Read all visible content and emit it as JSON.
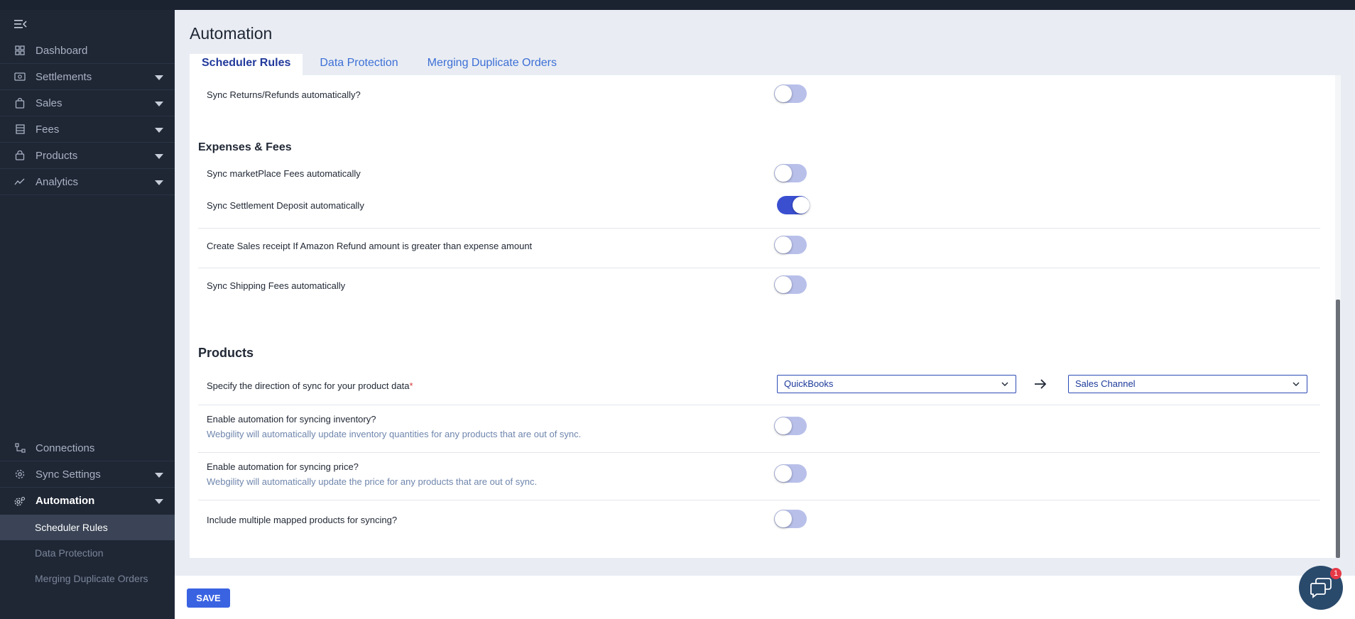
{
  "sidebar": {
    "items": [
      {
        "label": "Dashboard",
        "icon": "grid-icon"
      },
      {
        "label": "Settlements",
        "icon": "cash-icon"
      },
      {
        "label": "Sales",
        "icon": "bag-icon"
      },
      {
        "label": "Fees",
        "icon": "list-icon"
      },
      {
        "label": "Products",
        "icon": "basket-icon"
      },
      {
        "label": "Analytics",
        "icon": "trend-icon"
      }
    ],
    "bottom_items": [
      {
        "label": "Connections",
        "icon": "connections-icon"
      },
      {
        "label": "Sync Settings",
        "icon": "gear-icon"
      },
      {
        "label": "Automation",
        "icon": "automation-gear-icon"
      }
    ],
    "sub_items": [
      "Scheduler Rules",
      "Data Protection",
      "Merging Duplicate Orders"
    ]
  },
  "page": {
    "title": "Automation",
    "tabs": [
      "Scheduler Rules",
      "Data Protection",
      "Merging Duplicate Orders"
    ]
  },
  "rows": {
    "returns": "Sync Returns/Refunds automatically?",
    "expenses_title": "Expenses & Fees",
    "marketplace_fees": "Sync marketPlace Fees automatically",
    "settlement_deposit": "Sync Settlement Deposit automatically",
    "sales_receipt": "Create Sales receipt If Amazon Refund amount is greater than expense amount",
    "shipping_fees": "Sync Shipping Fees automatically",
    "products_title": "Products",
    "direction": "Specify the direction of sync for your product data",
    "required_mark": "*",
    "inventory": "Enable automation for syncing inventory?",
    "inventory_sub": "Webgility will automatically update inventory quantities for any products that are out of sync.",
    "price": "Enable automation for syncing price?",
    "price_sub": "Webgility will automatically update the price for any products that are out of sync.",
    "multiple_mapped": "Include multiple mapped products for syncing?"
  },
  "direction": {
    "source": "QuickBooks",
    "target": "Sales Channel"
  },
  "toggles": {
    "returns": false,
    "marketplace_fees": false,
    "settlement_deposit": true,
    "sales_receipt": false,
    "shipping_fees": false,
    "inventory": false,
    "price": false,
    "multiple_mapped": false
  },
  "footer": {
    "save_label": "SAVE",
    "chat_badge": "1"
  },
  "colors": {
    "accent": "#3a4fd0",
    "toggle_off": "#b8c0ea",
    "sidebar_bg": "#1f2735"
  }
}
